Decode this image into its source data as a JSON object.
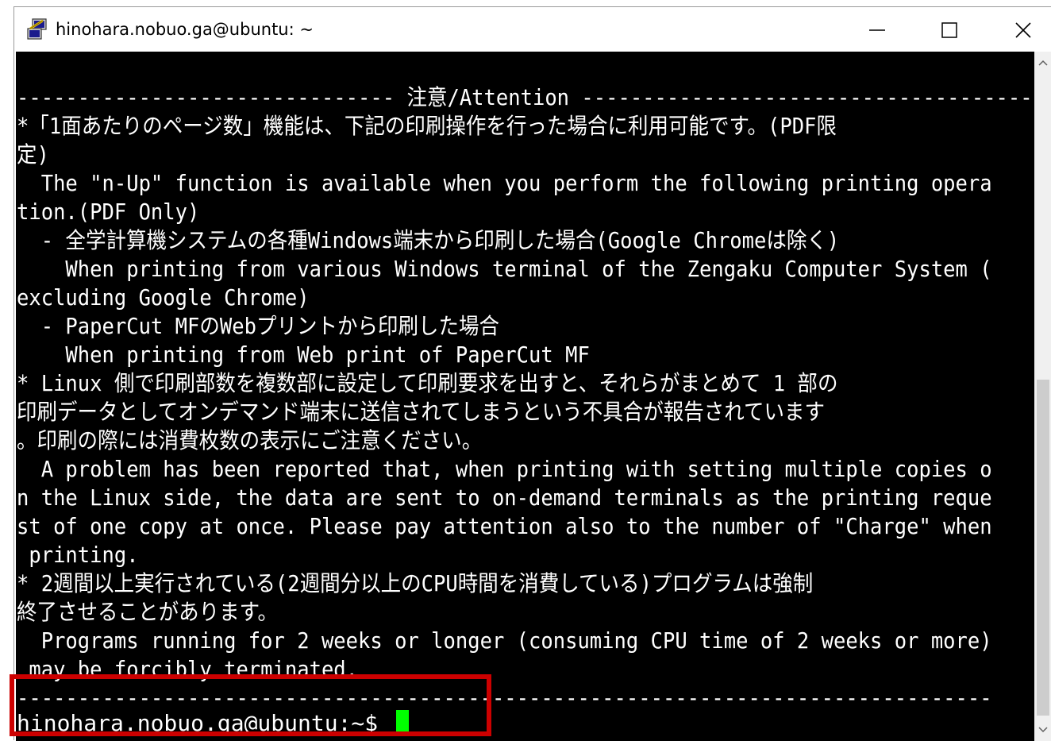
{
  "window": {
    "title": "hinohara.nobuo.ga@ubuntu: ~",
    "app_icon": "putty-icon",
    "controls": [
      "minimize-icon",
      "maximize-icon",
      "close-icon"
    ]
  },
  "terminal": {
    "lines": [
      "------------------------------- 注意/Attention -------------------------------------",
      "*「1面あたりのページ数」機能は、下記の印刷操作を行った場合に利用可能です。(PDF限",
      "定)",
      "  The \"n-Up\" function is available when you perform the following printing opera",
      "tion.(PDF Only)",
      "  - 全学計算機システムの各種Windows端末から印刷した場合(Google Chromeは除く)",
      "    When printing from various Windows terminal of the Zengaku Computer System (",
      "excluding Google Chrome)",
      "  - PaperCut MFのWebプリントから印刷した場合",
      "    When printing from Web print of PaperCut MF",
      "* Linux 側で印刷部数を複数部に設定して印刷要求を出すと、それらがまとめて 1 部の",
      "印刷データとしてオンデマンド端末に送信されてしまうという不具合が報告されています",
      "。印刷の際には消費枚数の表示にご注意ください。",
      "  A problem has been reported that, when printing with setting multiple copies o",
      "n the Linux side, the data are sent to on-demand terminals as the printing reque",
      "st of one copy at once. Please pay attention also to the number of \"Charge\" when",
      " printing.",
      "* 2週間以上実行されている(2週間分以上のCPU時間を消費している)プログラムは強制",
      "終了させることがあります。",
      "  Programs running for 2 weeks or longer (consuming CPU time of 2 weeks or more)",
      " may be forcibly terminated.",
      "--------------------------------------------------------------------------------"
    ],
    "prompt": "hinohara.nobuo.ga@ubuntu:~$ ",
    "cursor_color": "#00ff00",
    "background": "#000000",
    "foreground": "#ffffff"
  },
  "annotation": {
    "highlight_color": "#cc0000"
  }
}
